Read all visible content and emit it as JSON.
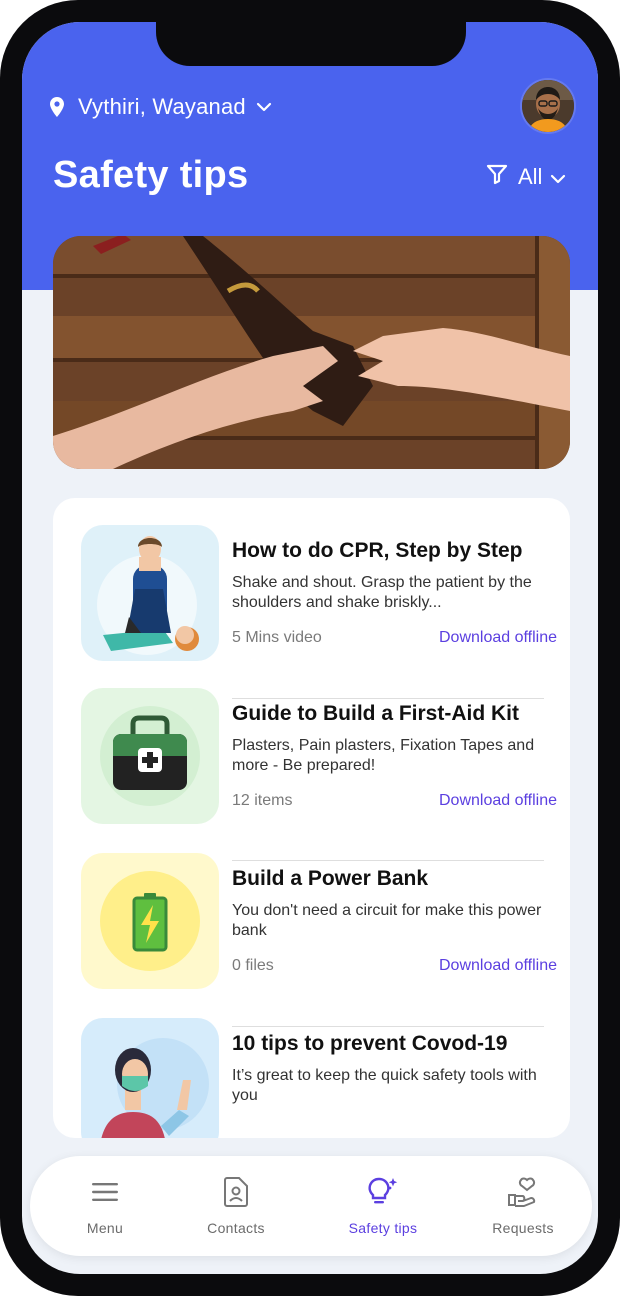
{
  "header": {
    "location": "Vythiri, Wayanad",
    "title": "Safety tips",
    "filter_label": "All",
    "accent_color": "#4a63ee"
  },
  "hero": {
    "image": "hands-reaching-photo"
  },
  "tips": [
    {
      "title": "How to do CPR, Step by Step",
      "description": "Shake and shout. Grasp the patient by the shoulders and shake briskly...",
      "meta": "5 Mins video",
      "link": "Download offline",
      "icon": "cpr-illustration",
      "bg_color": "#dff1f9"
    },
    {
      "title": "Guide to Build a First-Aid Kit",
      "description": "Plasters, Pain plasters, Fixation Tapes and more - Be prepared!",
      "meta": "12 items",
      "link": "Download offline",
      "icon": "first-aid-kit-icon",
      "bg_color": "#e4f6e3"
    },
    {
      "title": "Build a Power Bank",
      "description": "You don't need a circuit for make this power bank",
      "meta": "0 files",
      "link": "Download offline",
      "icon": "battery-icon",
      "bg_color": "#fff9cc"
    },
    {
      "title": "10 tips to prevent Covod-19",
      "description": "It’s great to keep the quick safety tools with you",
      "icon": "masked-person-illustration",
      "bg_color": "#d6ecfb"
    }
  ],
  "nav": {
    "items": [
      {
        "label": "Menu",
        "icon": "menu-icon"
      },
      {
        "label": "Contacts",
        "icon": "contacts-icon"
      },
      {
        "label": "Safety tips",
        "icon": "bulb-icon",
        "active": true
      },
      {
        "label": "Requests",
        "icon": "hand-heart-icon"
      }
    ],
    "active_color": "#5b3fe0"
  }
}
